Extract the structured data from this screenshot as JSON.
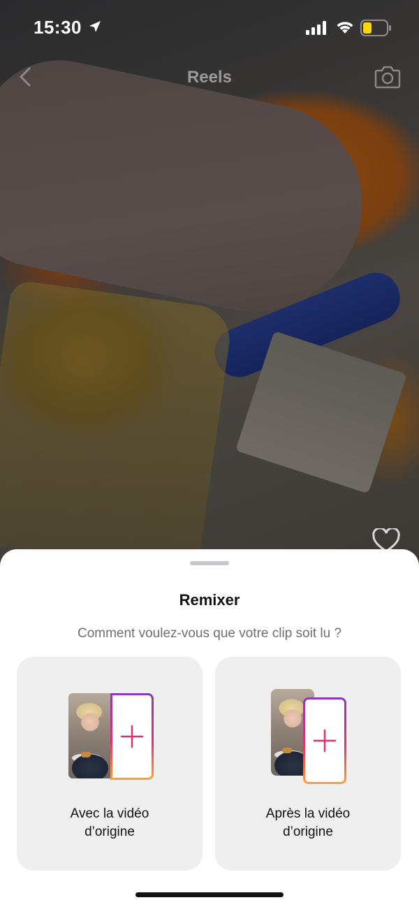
{
  "status_bar": {
    "time": "15:30"
  },
  "nav": {
    "title": "Reels"
  },
  "sheet": {
    "title": "Remixer",
    "subtitle": "Comment voulez-vous que votre clip soit lu ?",
    "options": [
      {
        "label_line1": "Avec la vidéo",
        "label_line2": "d’origine",
        "layout": "side-by-side"
      },
      {
        "label_line1": "Après la vidéo",
        "label_line2": "d’origine",
        "layout": "sequential"
      }
    ]
  },
  "colors": {
    "gradient_start": "#f9a23a",
    "gradient_mid": "#e1306c",
    "gradient_end": "#8a3ab9",
    "plus_icon": "#e1306c",
    "battery_fill": "#ffd60a"
  },
  "icons": [
    "location-arrow-icon",
    "cellular-signal-icon",
    "wifi-icon",
    "battery-icon",
    "chevron-left-icon",
    "camera-icon",
    "heart-icon",
    "plus-icon"
  ]
}
